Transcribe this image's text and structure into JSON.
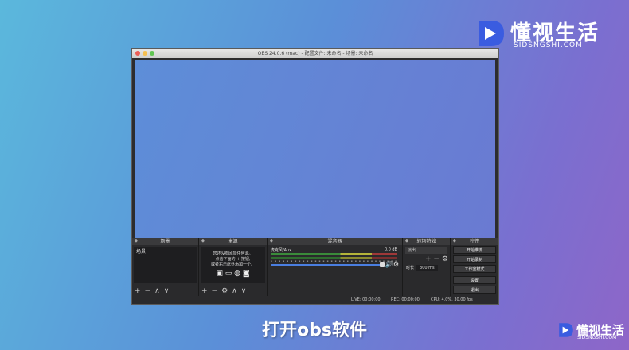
{
  "brand": {
    "cn": "懂视生活",
    "en": "SIDSNGSHI.COM",
    "accent": "#3a5ce0"
  },
  "window": {
    "title": "OBS 24.0.6 (mac) - 配置文件: 未命名 - 场景: 未命名"
  },
  "docks": {
    "scenes": {
      "title": "场景",
      "items": [
        "场景"
      ]
    },
    "sources": {
      "title": "来源",
      "hint_line1": "您还没有添加任何源。",
      "hint_line2": "点击下面的 + 按钮,",
      "hint_line3": "或者右击此处添加一个。"
    },
    "mixer": {
      "title": "混音器",
      "channel": "麦克风/Aux",
      "db": "0.0 dB"
    },
    "transitions": {
      "title": "转场特效",
      "selected": "淡出",
      "duration_label": "时长",
      "duration_value": "300 ms"
    },
    "controls": {
      "title": "控件",
      "start_stream": "开始推流",
      "start_record": "开始录制",
      "studio_mode": "工作室模式",
      "settings": "设置",
      "exit": "退出"
    }
  },
  "status": {
    "live": "LIVE: 00:00:00",
    "rec": "REC: 00:00:00",
    "cpu": "CPU: 4.0%, 30.00 fps"
  },
  "caption": "打开obs软件",
  "icons": {
    "plus": "+",
    "minus": "−",
    "up": "∧",
    "down": "∨",
    "gear": "⚙",
    "speaker": "🔊"
  }
}
